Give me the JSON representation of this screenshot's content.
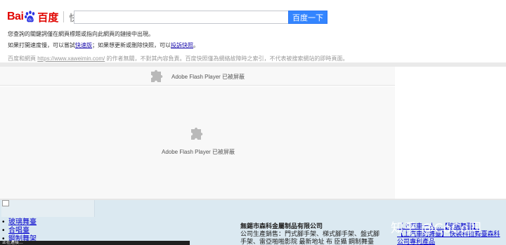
{
  "header": {
    "logo_bai": "Bai",
    "logo_cn": "百度",
    "logo_section": "快照",
    "search_value": "",
    "search_button": "百度一下"
  },
  "notices": {
    "line1": "您查詢的關鍵詞僅在網頁標題或指向此網頁的鏈接中出現。",
    "line2_prefix": "如果打開速度慢，可以嘗試",
    "line2_link1": "快速版",
    "line2_mid": "；如果想更新或刪除快照，可以",
    "line2_link2": "投訴快照",
    "line2_suffix": "。",
    "line3_prefix": "百度和網頁",
    "line3_url": "https://www.xaweimin.com/",
    "line3_suffix": "的作者無關，不對其內容負責。百度快照僅為網絡故障時之索引，不代表被搜索網站的即時頁面。"
  },
  "flash": {
    "label_top": "Adobe Flash Player 已被屏蔽",
    "label_main": "Adobe Flash Player 已被屏蔽"
  },
  "bottom": {
    "links": [
      "玻璃舞臺",
      "合唱臺",
      "鋼制舞架"
    ],
    "company_name": "無錫市森科金屬制品有限公司",
    "company_desc": "公司生產銷售：門式腳手架、梯式腳手架、盤式腳手架、雷亞啪啪影院 最新地址 布 臣攝 鋼制舞臺",
    "right_link1": "【上汽車一人…【玻璃舞臺】",
    "right_link2": "【上汽車的舞臺】 快裝科拉舞臺森科公司專利產品",
    "watermark": "知乎 @CoCo同",
    "status": "正在連接…"
  }
}
